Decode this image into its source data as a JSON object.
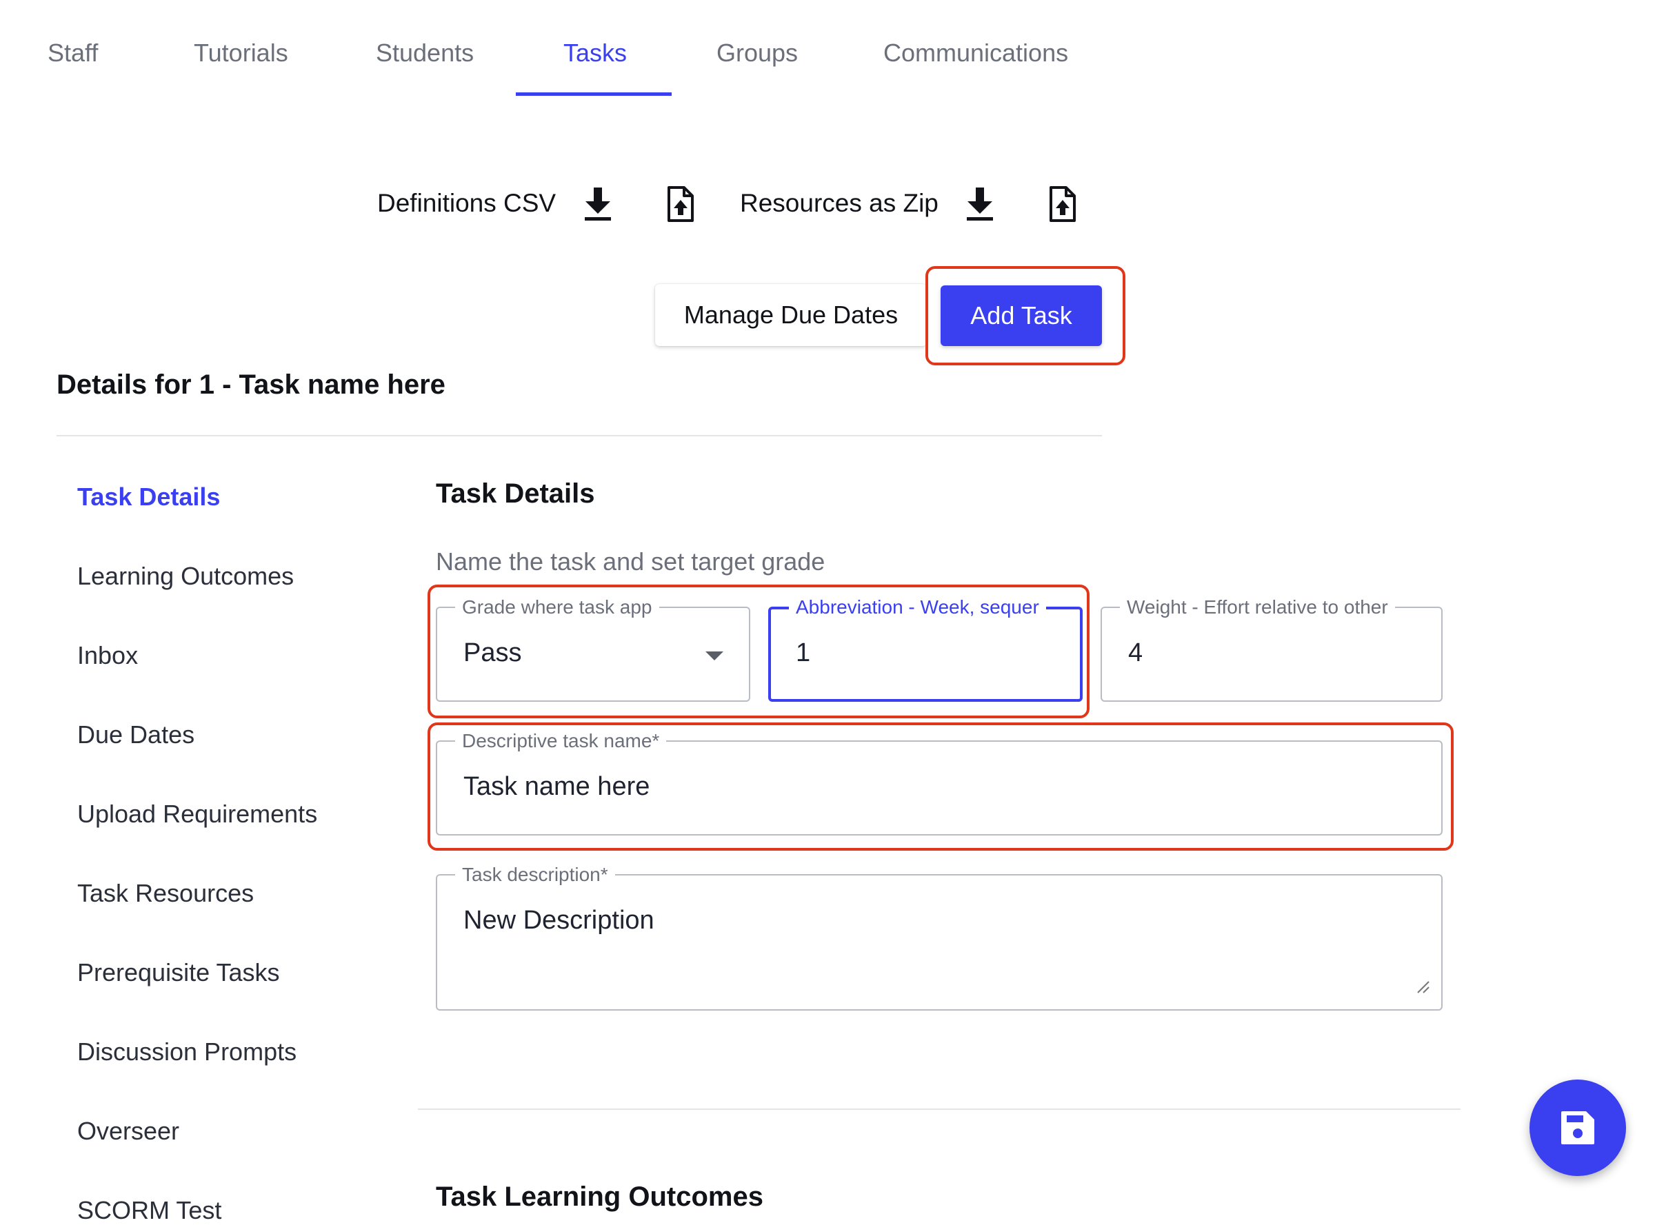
{
  "tabs": [
    {
      "label": "Staff",
      "active": false
    },
    {
      "label": "Tutorials",
      "active": false
    },
    {
      "label": "Students",
      "active": false
    },
    {
      "label": "Tasks",
      "active": true
    },
    {
      "label": "Groups",
      "active": false
    },
    {
      "label": "Communications",
      "active": false
    }
  ],
  "io": {
    "definitions_label": "Definitions CSV",
    "resources_label": "Resources as Zip",
    "download_icon": "download-icon",
    "upload_icon": "file-upload-icon"
  },
  "actions": {
    "manage_due_dates": "Manage Due Dates",
    "add_task": "Add Task"
  },
  "details_title": "Details for 1 - Task name here",
  "sidenav": [
    {
      "label": "Task Details",
      "active": true
    },
    {
      "label": "Learning Outcomes",
      "active": false
    },
    {
      "label": "Inbox",
      "active": false
    },
    {
      "label": "Due Dates",
      "active": false
    },
    {
      "label": "Upload Requirements",
      "active": false
    },
    {
      "label": "Task Resources",
      "active": false
    },
    {
      "label": "Prerequisite Tasks",
      "active": false
    },
    {
      "label": "Discussion Prompts",
      "active": false
    },
    {
      "label": "Overseer",
      "active": false
    },
    {
      "label": "SCORM Test",
      "active": false
    }
  ],
  "task_details": {
    "title": "Task Details",
    "subtitle": "Name the task and set target grade",
    "grade": {
      "label": "Grade where task app",
      "value": "Pass"
    },
    "abbreviation": {
      "label": "Abbreviation - Week, sequer",
      "value": "1"
    },
    "weight": {
      "label": "Weight - Effort relative to other",
      "value": "4"
    },
    "name": {
      "label": "Descriptive task name*",
      "value": "Task name here"
    },
    "description": {
      "label": "Task description*",
      "value": "New Description"
    }
  },
  "learning_outcomes": {
    "title": "Task Learning Outcomes"
  },
  "fab": {
    "icon": "save-icon"
  },
  "colors": {
    "accent": "#3a3ff0",
    "highlight": "#e0361a",
    "muted_text": "#6b6f7a",
    "border": "#b9bcc4"
  }
}
